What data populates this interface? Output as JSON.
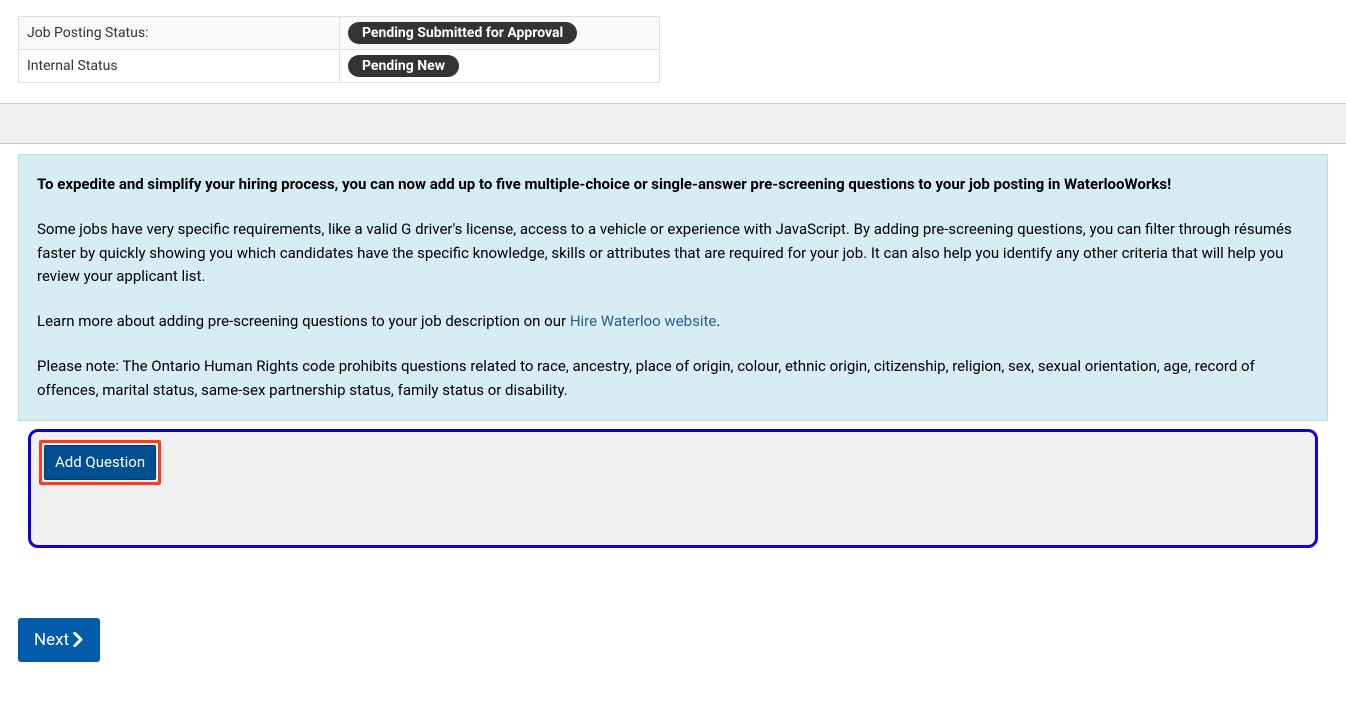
{
  "status_table": {
    "rows": [
      {
        "label": "Job Posting Status:",
        "badge": "Pending Submitted for Approval"
      },
      {
        "label": "Internal Status",
        "badge": "Pending New"
      }
    ]
  },
  "info": {
    "bold": "To expedite and simplify your hiring process, you can now add up to five multiple-choice or single-answer pre-screening questions to your job posting in WaterlooWorks!",
    "p1": "Some jobs have very specific requirements, like a valid G driver's license, access to a vehicle or experience with JavaScript. By adding pre-screening questions, you can filter through résumés faster by quickly showing you which candidates have the specific knowledge, skills or attributes that are required for your job. It can also help you identify any other criteria that will help you review your applicant list.",
    "p2_prefix": "Learn more about adding pre-screening questions to your job description on our ",
    "p2_link": "Hire Waterloo website",
    "p2_suffix": ".",
    "p3": "Please note: The Ontario Human Rights code prohibits questions related to race, ancestry, place of origin, colour, ethnic origin, citizenship, religion, sex, sexual orientation, age, record of offences, marital status, same-sex partnership status, family status or disability."
  },
  "buttons": {
    "add_question": "Add Question",
    "next": "Next"
  }
}
